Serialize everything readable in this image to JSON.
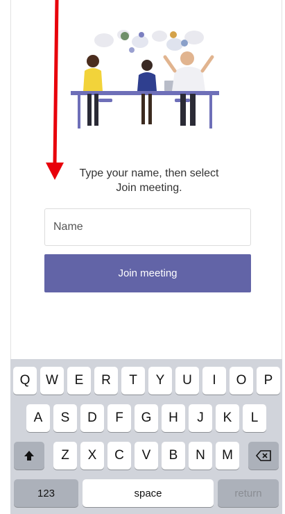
{
  "prompt": {
    "line1": "Type your name, then select",
    "line2": "Join meeting."
  },
  "name_input": {
    "placeholder": "Name",
    "value": ""
  },
  "join_button": {
    "label": "Join meeting"
  },
  "keyboard": {
    "row1": [
      "Q",
      "W",
      "E",
      "R",
      "T",
      "Y",
      "U",
      "I",
      "O",
      "P"
    ],
    "row2": [
      "A",
      "S",
      "D",
      "F",
      "G",
      "H",
      "J",
      "K",
      "L"
    ],
    "row3": [
      "Z",
      "X",
      "C",
      "V",
      "B",
      "N",
      "M"
    ],
    "shift_icon": "shift-icon",
    "delete_icon": "backspace-icon",
    "numbers_label": "123",
    "space_label": "space",
    "return_label": "return"
  },
  "colors": {
    "accent": "#6264a7",
    "annotation_arrow": "#e8000b",
    "keyboard_bg": "#d1d4db"
  }
}
